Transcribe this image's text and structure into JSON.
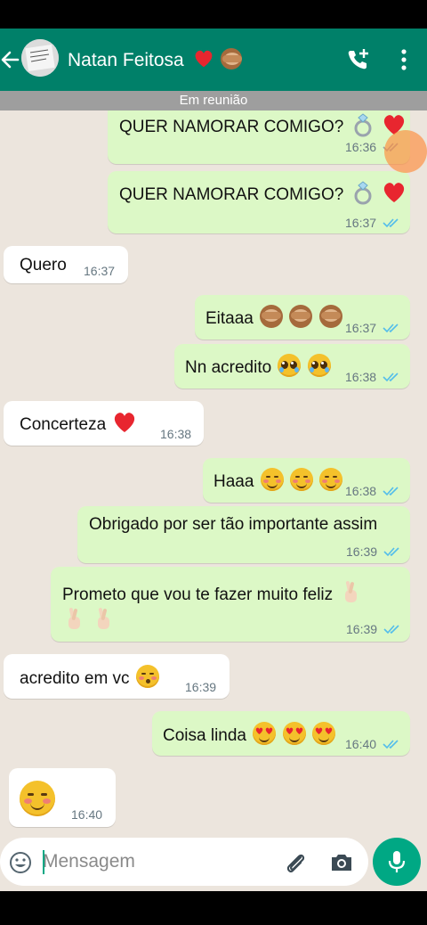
{
  "header": {
    "contact_name": "Natan Feitosa",
    "status_strip": "Em reunião",
    "color": "#008069"
  },
  "messages": [
    {
      "dir": "out",
      "text": "QUER NAMORAR COMIGO?",
      "emojis": [
        "ring-icon",
        "heart-icon"
      ],
      "time": "16:36",
      "ticks": "gray"
    },
    {
      "dir": "out",
      "text": "QUER NAMORAR COMIGO?",
      "emojis": [
        "ring-icon",
        "heart-icon"
      ],
      "time": "16:37",
      "ticks": "blue"
    },
    {
      "dir": "in",
      "text": "Quero",
      "time": "16:37"
    },
    {
      "dir": "out",
      "text": "Eitaaa",
      "emojis": [
        "see-no-evil-monkey-icon",
        "see-no-evil-monkey-icon",
        "see-no-evil-monkey-icon"
      ],
      "time": "16:37",
      "ticks": "blue"
    },
    {
      "dir": "out",
      "text": "Nn acredito",
      "emojis": [
        "pleading-face-icon",
        "pleading-face-icon"
      ],
      "time": "16:38",
      "ticks": "blue"
    },
    {
      "dir": "in",
      "text": "Concerteza",
      "emojis": [
        "heart-icon"
      ],
      "time": "16:38"
    },
    {
      "dir": "out",
      "text": "Haaa",
      "emojis": [
        "smiling-face-icon",
        "smiling-face-icon",
        "smiling-face-icon"
      ],
      "time": "16:38",
      "ticks": "blue"
    },
    {
      "dir": "out",
      "text": "Obrigado por ser tão importante assim",
      "time": "16:39",
      "ticks": "blue"
    },
    {
      "dir": "out",
      "text": "Prometo que vou te fazer muito feliz",
      "emojis": [
        "crossed-fingers-icon",
        "crossed-fingers-icon",
        "crossed-fingers-icon"
      ],
      "time": "16:39",
      "ticks": "blue"
    },
    {
      "dir": "in",
      "text": "acredito em vc",
      "emojis": [
        "kissing-face-icon"
      ],
      "time": "16:39"
    },
    {
      "dir": "out",
      "text": "Coisa linda",
      "emojis": [
        "heart-eyes-icon",
        "heart-eyes-icon",
        "heart-eyes-icon"
      ],
      "time": "16:40",
      "ticks": "blue"
    },
    {
      "dir": "in",
      "text": "",
      "emojis": [
        "smiling-face-icon"
      ],
      "time": "16:40"
    }
  ],
  "composer": {
    "placeholder": "Mensagem"
  },
  "colors": {
    "outgoing_bubble": "#dcf8c6",
    "incoming_bubble": "#ffffff",
    "read_ticks": "#53bdeb",
    "accent": "#00a884"
  }
}
